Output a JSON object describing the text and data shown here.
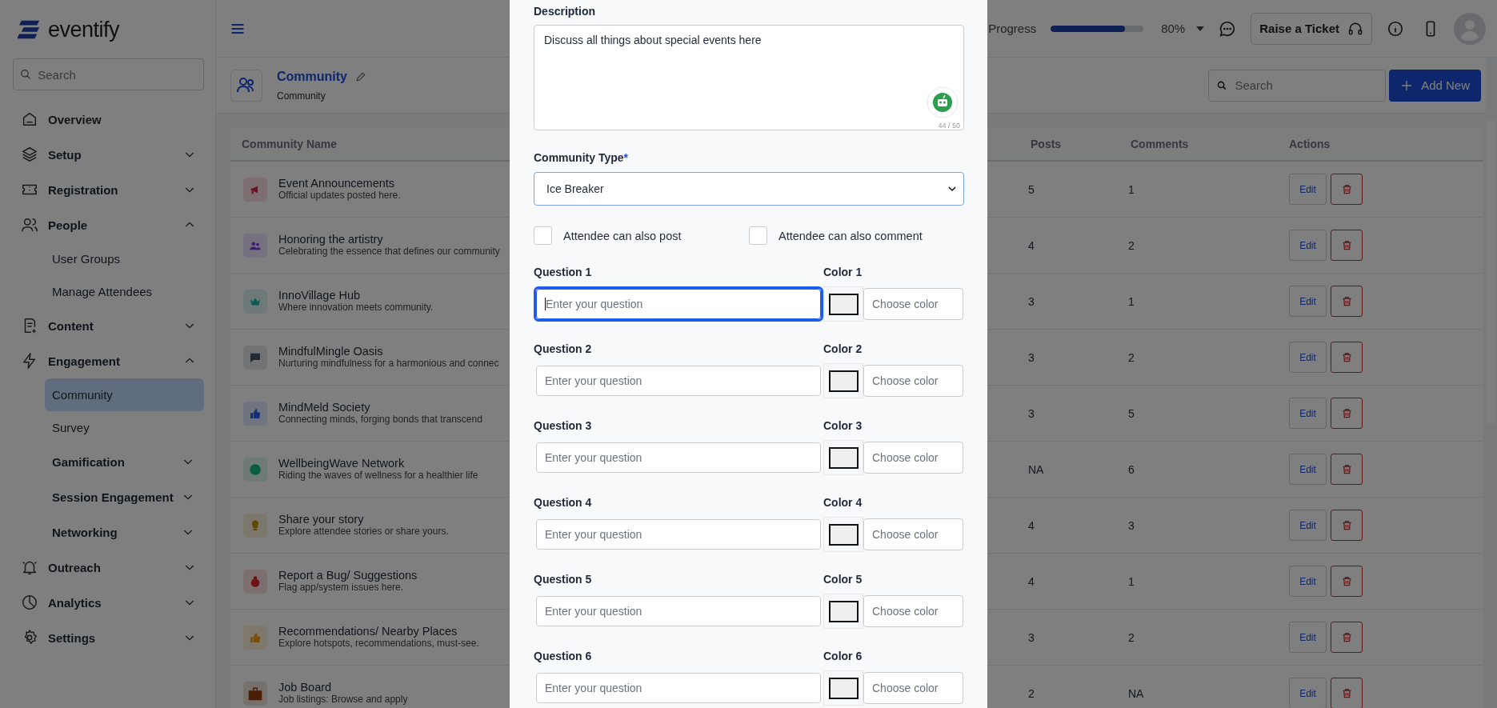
{
  "sidebar": {
    "logo": "eventify",
    "search": {
      "placeholder": "Search"
    },
    "items": [
      {
        "label": "Overview",
        "kind": "link",
        "selected": false
      },
      {
        "label": "Setup",
        "kind": "group",
        "expanded": false,
        "selected": false
      },
      {
        "label": "Registration",
        "kind": "group",
        "expanded": false,
        "selected": false
      },
      {
        "label": "People",
        "kind": "group",
        "expanded": true,
        "selected": false,
        "children": [
          {
            "label": "User Groups",
            "kind": "link",
            "selected": false
          },
          {
            "label": "Manage Attendees",
            "kind": "link",
            "selected": false
          }
        ]
      },
      {
        "label": "Content",
        "kind": "group",
        "expanded": false,
        "selected": false
      },
      {
        "label": "Engagement",
        "kind": "group",
        "expanded": true,
        "selected": false,
        "children": [
          {
            "label": "Community",
            "kind": "link",
            "selected": true
          },
          {
            "label": "Survey",
            "kind": "link",
            "selected": false
          },
          {
            "label": "Gamification",
            "kind": "group",
            "expanded": false,
            "selected": false
          },
          {
            "label": "Session Engagement",
            "kind": "group",
            "expanded": false,
            "selected": false
          },
          {
            "label": "Networking",
            "kind": "group",
            "expanded": false,
            "selected": false
          }
        ]
      },
      {
        "label": "Outreach",
        "kind": "group",
        "expanded": false,
        "selected": false
      },
      {
        "label": "Analytics",
        "kind": "group",
        "expanded": false,
        "selected": false
      },
      {
        "label": "Settings",
        "kind": "group",
        "expanded": false,
        "selected": false
      }
    ]
  },
  "top_bar": {
    "progress": {
      "label": "Progress",
      "level": 0.8,
      "reading": "80%"
    },
    "ticket_button": "Raise a Ticket"
  },
  "page_header": {
    "title": "Community",
    "subtitle": "Community",
    "search": {
      "placeholder": "Search"
    },
    "add_button": "Add New"
  },
  "table": {
    "columns": [
      "Community Name",
      "Posts",
      "Comments",
      "Actions"
    ],
    "rows": [
      {
        "name": "Event Announcements",
        "description": "Official updates posted here.",
        "posts": "5",
        "comments": "1",
        "edit": "Edit"
      },
      {
        "name": "Honoring the artistry",
        "description": "Celebrating the essence that defines our community",
        "posts": "4",
        "comments": "2",
        "edit": "Edit"
      },
      {
        "name": "InnoVillage Hub",
        "description": "Where innovation meets community.",
        "posts": "3",
        "comments": "1",
        "edit": "Edit"
      },
      {
        "name": "MindfulMingle Oasis",
        "description": "Nurturing mindfulness for a harmonious and connec",
        "posts": "3",
        "comments": "2",
        "edit": "Edit"
      },
      {
        "name": "MindMeld Society",
        "description": "Connecting minds, forging bonds that transcend",
        "posts": "3",
        "comments": "5",
        "edit": "Edit"
      },
      {
        "name": "WellbeingWave Network",
        "description": "Riding the waves of wellness for a healthier life",
        "posts": "NA",
        "comments": "6",
        "edit": "Edit"
      },
      {
        "name": "Share your story",
        "description": "Explore attendee stories or share yours.",
        "posts": "4",
        "comments": "3",
        "edit": "Edit"
      },
      {
        "name": "Report a Bug/ Suggestions",
        "description": "Flag app/system issues here.",
        "posts": "4",
        "comments": "1",
        "edit": "Edit"
      },
      {
        "name": "Recommendations/ Nearby Places",
        "description": "Explore hotspots, recommendations, must-see.",
        "posts": "3",
        "comments": "2",
        "edit": "Edit"
      },
      {
        "name": "Job Board",
        "description": "Job listings: Browse and apply",
        "posts": "2",
        "comments": "NA",
        "edit": "Edit"
      }
    ]
  },
  "modal": {
    "description": {
      "label": "Description",
      "value": "Discuss all things about special events here",
      "counter": "44 / 50"
    },
    "community_type": {
      "label": "Community Type",
      "required": true,
      "required_mark": "*",
      "value": "Ice Breaker"
    },
    "checkboxes": [
      {
        "label": "Attendee can also post",
        "checked": false
      },
      {
        "label": "Attendee can also comment",
        "checked": false
      }
    ],
    "questions": [
      {
        "label": "Question 1",
        "placeholder": "Enter your question",
        "focused": true,
        "color_label": "Color 1",
        "color_placeholder": "Choose color"
      },
      {
        "label": "Question 2",
        "placeholder": "Enter your question",
        "focused": false,
        "color_label": "Color 2",
        "color_placeholder": "Choose color"
      },
      {
        "label": "Question 3",
        "placeholder": "Enter your question",
        "focused": false,
        "color_label": "Color 3",
        "color_placeholder": "Choose color"
      },
      {
        "label": "Question 4",
        "placeholder": "Enter your question",
        "focused": false,
        "color_label": "Color 4",
        "color_placeholder": "Choose color"
      },
      {
        "label": "Question 5",
        "placeholder": "Enter your question",
        "focused": false,
        "color_label": "Color 5",
        "color_placeholder": "Choose color"
      },
      {
        "label": "Question 6",
        "placeholder": "Enter your question",
        "focused": false,
        "color_label": "Color 6",
        "color_placeholder": "Choose color"
      }
    ]
  }
}
